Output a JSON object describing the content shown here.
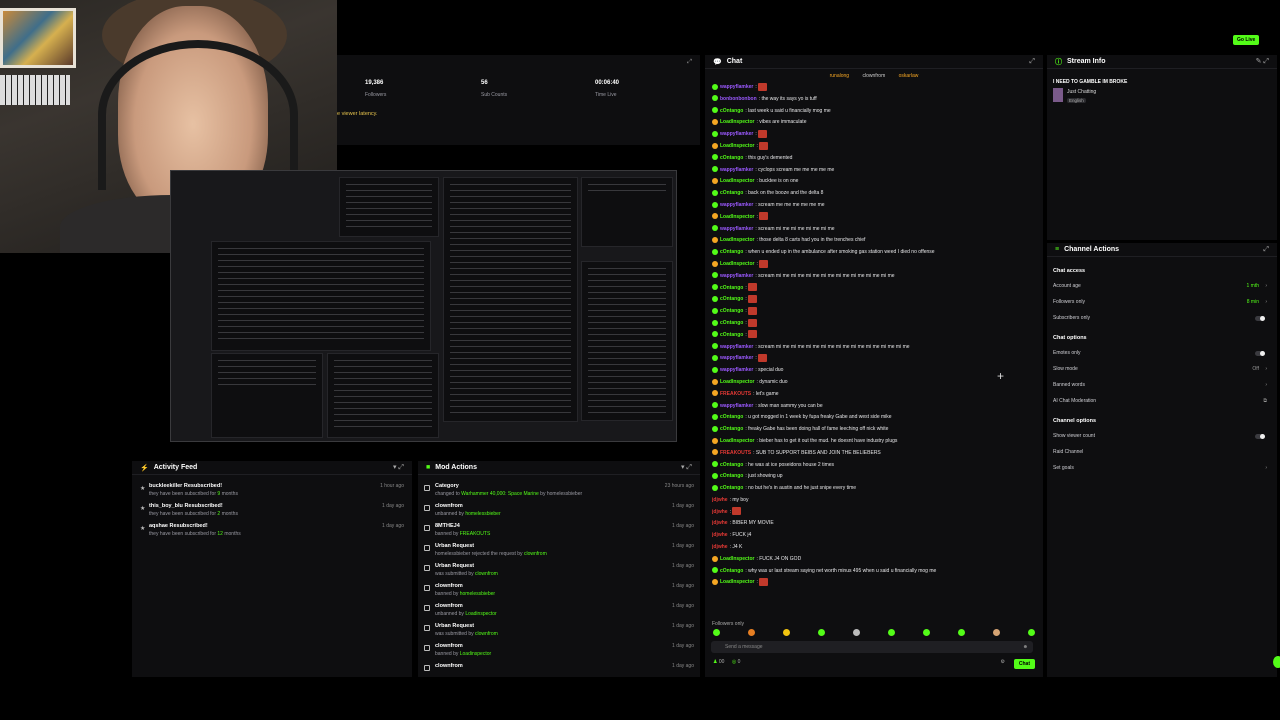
{
  "top_bar": {
    "go_live": "Go Live"
  },
  "stats": {
    "items": [
      {
        "value": "19,386",
        "label": "Followers"
      },
      {
        "value": "56",
        "label": "Sub Counts"
      },
      {
        "value": "00:06:40",
        "label": "Time Live"
      }
    ],
    "latency_notice": "e viewer latency."
  },
  "activity_feed": {
    "title": "Activity Feed",
    "items": [
      {
        "title": "buckleekiller Resubscribed!",
        "sub_pre": "they have been subscribed for",
        "count": "9",
        "sub_post": "months",
        "time": "1 hour ago"
      },
      {
        "title": "this_boy_blu Resubscribed!",
        "sub_pre": "they have been subscribed for",
        "count": "2",
        "sub_post": "months",
        "time": "1 day ago"
      },
      {
        "title": "aqshae Resubscribed!",
        "sub_pre": "they have been subscribed for",
        "count": "12",
        "sub_post": "months",
        "time": "1 day ago"
      }
    ]
  },
  "mod_actions": {
    "title": "Mod Actions",
    "items": [
      {
        "title": "Category",
        "pre": "changed to",
        "hl": "Warhammer 40,000: Space Marine",
        "post": "by homelessbieber",
        "time": "23 hours ago"
      },
      {
        "title": "clownfrom",
        "pre": "unbanned by",
        "hl": "homelessbieber",
        "post": "",
        "time": "1 day ago"
      },
      {
        "title": "8MTHEJ4",
        "pre": "banned by",
        "hl": "FREAKOUTS",
        "post": "",
        "time": "1 day ago"
      },
      {
        "title": "Urban Request",
        "pre": "homelessbieber rejected the request by",
        "hl": "clownfrom",
        "post": "",
        "time": "1 day ago"
      },
      {
        "title": "Urban Request",
        "pre": "was submitted by",
        "hl": "clownfrom",
        "post": "",
        "time": "1 day ago"
      },
      {
        "title": "clownfrom",
        "pre": "banned by",
        "hl": "homelessbieber",
        "post": "",
        "time": "1 day ago"
      },
      {
        "title": "clownfrom",
        "pre": "unbanned by",
        "hl": "Loadinspector",
        "post": "",
        "time": "1 day ago"
      },
      {
        "title": "Urban Request",
        "pre": "was submitted by",
        "hl": "clownfrom",
        "post": "",
        "time": "1 day ago"
      },
      {
        "title": "clownfrom",
        "pre": "banned by",
        "hl": "Loadinspector",
        "post": "",
        "time": "1 day ago"
      },
      {
        "title": "clownfrom",
        "pre": "",
        "hl": "",
        "post": "",
        "time": "1 day ago"
      }
    ]
  },
  "chat": {
    "title": "Chat",
    "pinned": [
      "runalong",
      "clownfrom",
      "oskarlaw"
    ],
    "messages": [
      {
        "user": "wappyflamker",
        "color": "#9b59ff",
        "text": "",
        "emote": true,
        "badge": "g"
      },
      {
        "user": "bonbonbonbon",
        "color": "#9b59ff",
        "text": "the way its says yo is tuff",
        "badge": "g"
      },
      {
        "user": "cOntango",
        "color": "#53fc18",
        "text": "last week u said u financially mog me",
        "badge": "g"
      },
      {
        "user": "LoadInspector",
        "color": "#53fc18",
        "text": "vibes are immaculate",
        "badge": "o"
      },
      {
        "user": "wappyflamker",
        "color": "#9b59ff",
        "text": "",
        "emote": true,
        "badge": "g"
      },
      {
        "user": "LoadInspector",
        "color": "#53fc18",
        "text": "",
        "emote": true,
        "badge": "o"
      },
      {
        "user": "cOntango",
        "color": "#53fc18",
        "text": "this guy's demented",
        "badge": "g"
      },
      {
        "user": "wappyflamker",
        "color": "#9b59ff",
        "text": "cyclops scream me me me me me",
        "badge": "g"
      },
      {
        "user": "LoadInspector",
        "color": "#53fc18",
        "text": "bucktee is on one",
        "badge": "o"
      },
      {
        "user": "cOntango",
        "color": "#53fc18",
        "text": "back on the booze and the delta 8",
        "badge": "g"
      },
      {
        "user": "wappyflamker",
        "color": "#9b59ff",
        "text": "scream me me me me me me",
        "badge": "g"
      },
      {
        "user": "LoadInspector",
        "color": "#53fc18",
        "text": "",
        "emote": true,
        "badge": "o"
      },
      {
        "user": "wappyflamker",
        "color": "#9b59ff",
        "text": "scream mi me mi me mi me mi me",
        "badge": "g"
      },
      {
        "user": "LoadInspector",
        "color": "#53fc18",
        "text": "those delta 8 carts had you in the trenches chief",
        "badge": "o"
      },
      {
        "user": "cOntango",
        "color": "#53fc18",
        "text": "when u ended up in the ambulance after smoking gas station weed I died no offense",
        "badge": "g"
      },
      {
        "user": "LoadInspector",
        "color": "#53fc18",
        "text": "",
        "emote": true,
        "badge": "o"
      },
      {
        "user": "wappyflamker",
        "color": "#9b59ff",
        "text": "scream mi me mi me mi me mi me mi me mi me mi me mi me",
        "badge": "g"
      },
      {
        "user": "cOntango",
        "color": "#53fc18",
        "text": "",
        "emote": true,
        "badge": "g"
      },
      {
        "user": "cOntango",
        "color": "#53fc18",
        "text": "",
        "emote": true,
        "badge": "g"
      },
      {
        "user": "cOntango",
        "color": "#53fc18",
        "text": "",
        "emote": true,
        "badge": "g"
      },
      {
        "user": "cOntango",
        "color": "#53fc18",
        "text": "",
        "emote": true,
        "badge": "g"
      },
      {
        "user": "cOntango",
        "color": "#53fc18",
        "text": "",
        "emote": true,
        "badge": "g"
      },
      {
        "user": "wappyflamker",
        "color": "#9b59ff",
        "text": "scream mi me mi me mi me mi me mi me mi me mi me mi me mi me",
        "badge": "g"
      },
      {
        "user": "wappyflamker",
        "color": "#9b59ff",
        "text": "",
        "emote": true,
        "badge": "g"
      },
      {
        "user": "wappyflamker",
        "color": "#9b59ff",
        "text": "special duo",
        "badge": "g"
      },
      {
        "user": "LoadInspector",
        "color": "#53fc18",
        "text": "dynamic duo",
        "badge": "o"
      },
      {
        "user": "FREAKOUTS",
        "color": "#e53935",
        "text": "let's game",
        "badge": "o"
      },
      {
        "user": "wappyflamker",
        "color": "#9b59ff",
        "text": "slow man sammy you can be",
        "badge": "g"
      },
      {
        "user": "cOntango",
        "color": "#53fc18",
        "text": "u got mogged in 1 week by fupa freaky Gabe and west side mike",
        "badge": "g"
      },
      {
        "user": "cOntango",
        "color": "#53fc18",
        "text": "freaky Gabe has been doing hall of fame leeching off nick white",
        "badge": "g"
      },
      {
        "user": "LoadInspector",
        "color": "#53fc18",
        "text": "bieber has to get it out the mud. he doesnt have industry plugs",
        "badge": "o"
      },
      {
        "user": "FREAKOUTS",
        "color": "#e53935",
        "text": "SUB TO SUPPORT BEIBS AND JOIN THE BELIEBERS",
        "badge": "o"
      },
      {
        "user": "cOntango",
        "color": "#53fc18",
        "text": "he was at ice poseidons house 2 times",
        "badge": "g"
      },
      {
        "user": "cOntango",
        "color": "#53fc18",
        "text": "just showing up",
        "badge": "g"
      },
      {
        "user": "cOntango",
        "color": "#53fc18",
        "text": "no but he's in austin and he just snipe every time",
        "badge": "g"
      },
      {
        "user": "jdjwhe",
        "color": "#e53935",
        "text": "my boy",
        "badge": ""
      },
      {
        "user": "jdjwhe",
        "color": "#e53935",
        "text": "",
        "emote": true,
        "badge": ""
      },
      {
        "user": "jdjwhe",
        "color": "#e53935",
        "text": "BIBER MY MOVIE",
        "badge": ""
      },
      {
        "user": "jdjwhe",
        "color": "#e53935",
        "text": "FUCK j4",
        "badge": ""
      },
      {
        "user": "jdjwhe",
        "color": "#e53935",
        "text": "J4 K",
        "badge": ""
      },
      {
        "user": "LoadInspector",
        "color": "#53fc18",
        "text": "FUCK J4 ON GOD",
        "badge": "o"
      },
      {
        "user": "cOntango",
        "color": "#53fc18",
        "text": "why was ur last stream saying net worth minus 495 when u said u financially mog me",
        "badge": "g"
      },
      {
        "user": "LoadInspector",
        "color": "#53fc18",
        "text": "",
        "emote": true,
        "badge": "o"
      }
    ],
    "followers_only": "Followers only",
    "input_placeholder": "Send a message",
    "bottom_left": "00",
    "bottom_count": "0",
    "send_label": "Chat"
  },
  "stream_info": {
    "title": "Stream Info",
    "stream_title": "I NEED TO GAMBLE IM BROKE",
    "category": "Just Chatting",
    "language": "English"
  },
  "channel_actions": {
    "title": "Channel Actions",
    "chat_access": "Chat access",
    "account_age": {
      "label": "Account age",
      "value": "1 mth"
    },
    "followers_only": {
      "label": "Followers only",
      "value": "8 min"
    },
    "subscribers_only": "Subscribers only",
    "chat_options": "Chat options",
    "emotes_only": "Emotes only",
    "slow_mode": {
      "label": "Slow mode",
      "value": "Off"
    },
    "banned_words": "Banned words",
    "ai_moderation": "AI Chat Moderation",
    "channel_options": "Channel options",
    "show_viewer_count": "Show viewer count",
    "raid_channel": "Raid Channel",
    "set_goals": "Set goals"
  }
}
